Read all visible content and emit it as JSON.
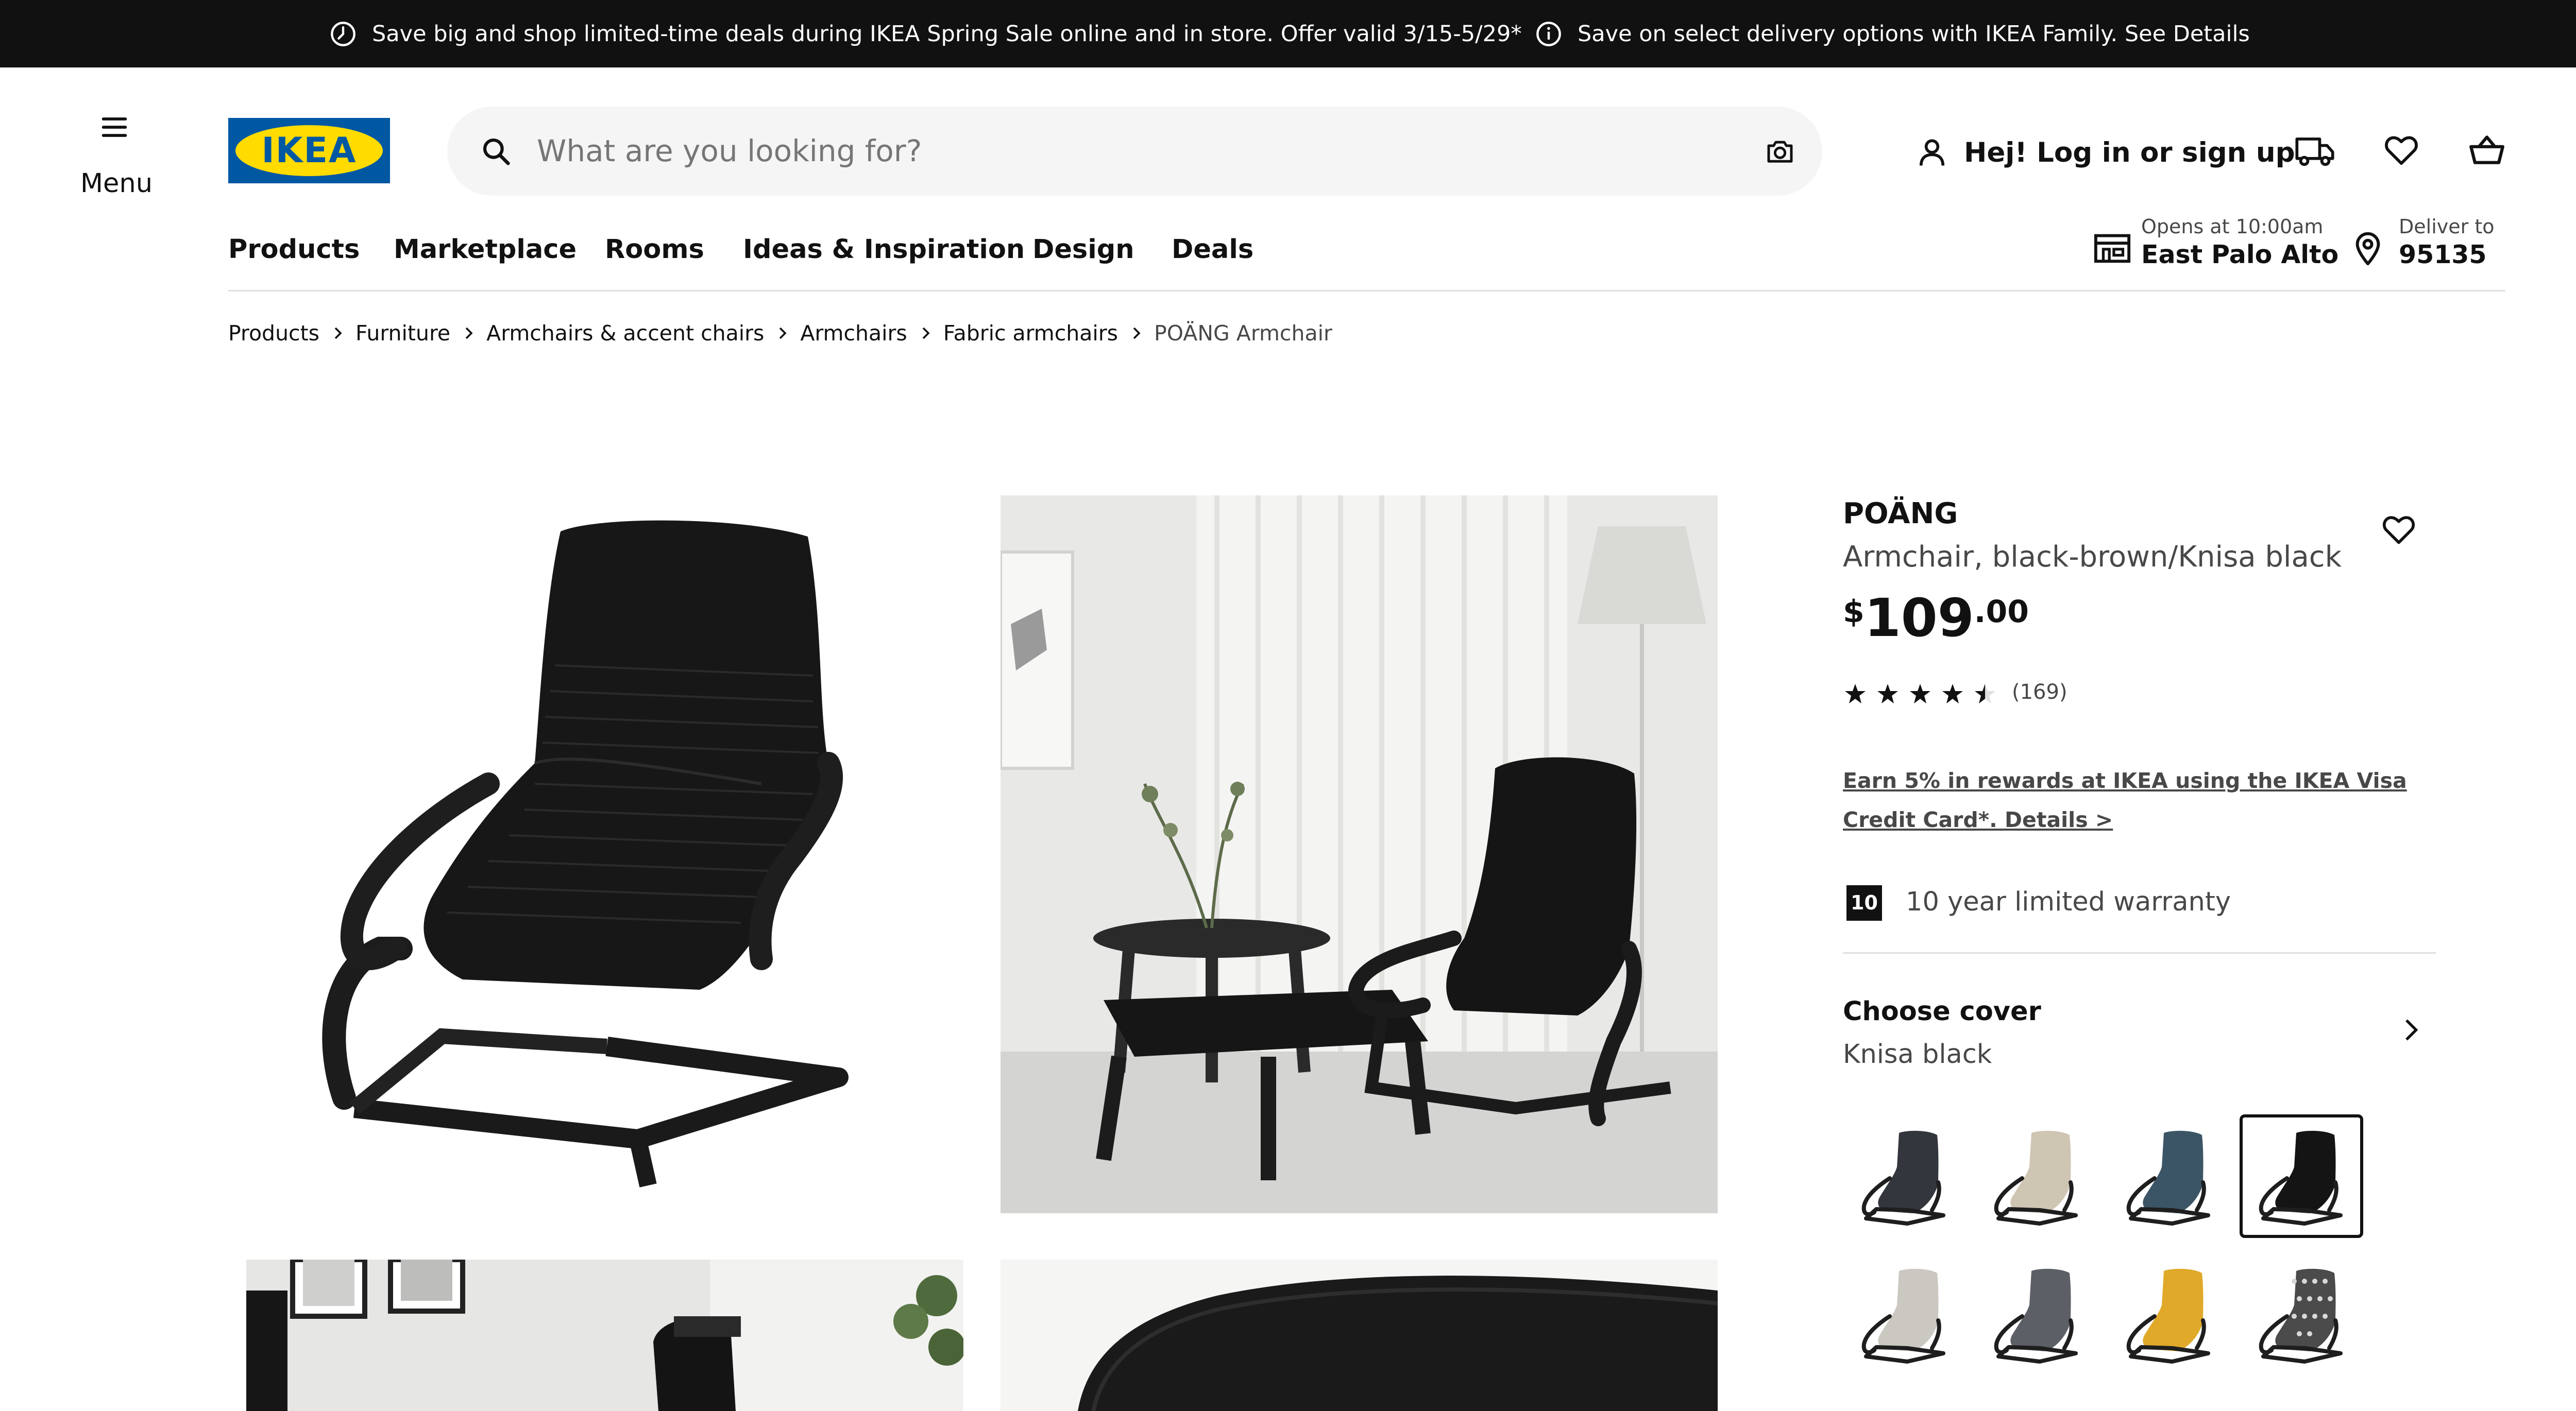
{
  "promo_bar": {
    "item1": "Save big and shop limited-time deals during IKEA Spring Sale online and in store. Offer valid 3/15-5/29*",
    "item2": "Save on select delivery options with IKEA Family. See Details"
  },
  "header": {
    "menu_label": "Menu",
    "logo_text": "IKEA",
    "search_placeholder": "What are you looking for?",
    "login_label": "Hej! Log in or sign up"
  },
  "nav": {
    "items": [
      "Products",
      "Marketplace",
      "Rooms",
      "Ideas & Inspiration",
      "Design",
      "Deals"
    ],
    "store_label": "Opens at 10:00am",
    "store_name": "East Palo Alto",
    "deliver_label": "Deliver to",
    "deliver_zip": "95135"
  },
  "breadcrumb": [
    "Products",
    "Furniture",
    "Armchairs & accent chairs",
    "Armchairs",
    "Fabric armchairs",
    "POÄNG Armchair"
  ],
  "product": {
    "name": "POÄNG",
    "description": "Armchair, black-brown/Knisa black",
    "price_currency": "$",
    "price_int": "109",
    "price_dec": ".00",
    "rating_value": 4.5,
    "rating_max": 5,
    "rating_count": "(169)",
    "rewards_text": "Earn 5% in rewards at IKEA using the IKEA Visa Credit Card*. Details >",
    "warranty_badge": "10",
    "warranty_text": "10 year limited warranty",
    "choose_cover_label": "Choose cover",
    "cover_value": "Knisa black"
  },
  "swatches": [
    {
      "name": "dark-blue-gray",
      "cushion": "#33363c",
      "selected": false
    },
    {
      "name": "beige",
      "cushion": "#cfc5b3",
      "selected": false
    },
    {
      "name": "blue",
      "cushion": "#3c5566",
      "selected": false
    },
    {
      "name": "black",
      "cushion": "#141414",
      "selected": true
    },
    {
      "name": "light-gray",
      "cushion": "#cbc8c1",
      "selected": false
    },
    {
      "name": "medium-gray",
      "cushion": "#5c5f66",
      "selected": false
    },
    {
      "name": "yellow",
      "cushion": "#e0a92a",
      "selected": false
    },
    {
      "name": "patterned",
      "cushion": "#4b4b4b",
      "selected": false
    }
  ],
  "colors": {
    "promo_bg": "#111111",
    "logo_blue": "#0058a3",
    "logo_yellow": "#ffdb00",
    "text_primary": "#111111",
    "text_secondary": "#484848"
  },
  "icons": {
    "promo1": "clock-icon",
    "promo2": "info-icon",
    "menu": "hamburger-icon",
    "search": "search-icon",
    "camera": "camera-icon",
    "user": "user-icon",
    "truck": "truck-icon",
    "heart": "heart-icon",
    "basket": "basket-icon",
    "store": "store-icon",
    "location": "location-pin-icon",
    "favorite": "heart-icon",
    "chevron": "chevron-right-icon"
  }
}
